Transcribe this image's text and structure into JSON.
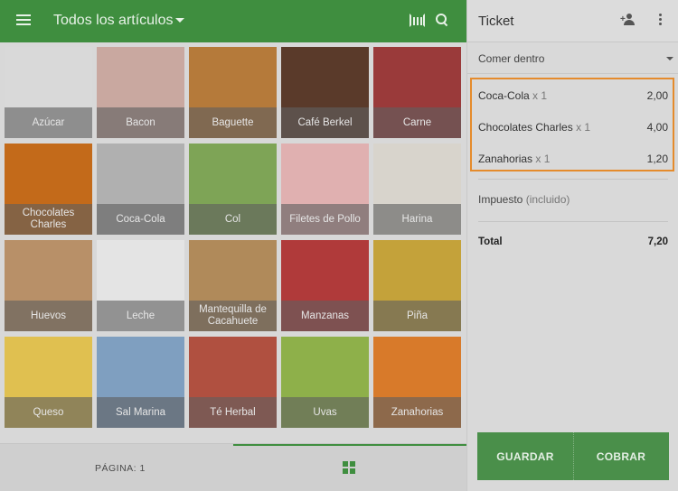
{
  "header": {
    "title": "Todos los artículos"
  },
  "products": [
    {
      "label": "Azúcar",
      "color": "#d9d9d9"
    },
    {
      "label": "Bacon",
      "color": "#c9a8a0"
    },
    {
      "label": "Baguette",
      "color": "#b57a3a"
    },
    {
      "label": "Café Berkel",
      "color": "#5a3a2a"
    },
    {
      "label": "Carne",
      "color": "#9a3a3a"
    },
    {
      "label": "Chocolates Charles",
      "color": "#c36a1a"
    },
    {
      "label": "Coca-Cola",
      "color": "#b0b0b0"
    },
    {
      "label": "Col",
      "color": "#7ea456"
    },
    {
      "label": "Filetes de Pollo",
      "color": "#e0b0b0"
    },
    {
      "label": "Harina",
      "color": "#d8d4cc"
    },
    {
      "label": "Huevos",
      "color": "#b89068"
    },
    {
      "label": "Leche",
      "color": "#e4e4e4"
    },
    {
      "label": "Mantequilla de Cacahuete",
      "color": "#b08a5a"
    },
    {
      "label": "Manzanas",
      "color": "#b03a3a"
    },
    {
      "label": "Piña",
      "color": "#c4a23a"
    },
    {
      "label": "Queso",
      "color": "#e0c050"
    },
    {
      "label": "Sal Marina",
      "color": "#7f9fc0"
    },
    {
      "label": "Té Herbal",
      "color": "#b05040"
    },
    {
      "label": "Uvas",
      "color": "#8eb04a"
    },
    {
      "label": "Zanahorias",
      "color": "#d87a2a"
    }
  ],
  "footer": {
    "page_label": "PÁGINA: 1"
  },
  "ticket": {
    "title": "Ticket",
    "dining_option": "Comer dentro",
    "items": [
      {
        "name": "Coca-Cola",
        "qty": "x 1",
        "price": "2,00"
      },
      {
        "name": "Chocolates Charles",
        "qty": "x 1",
        "price": "4,00"
      },
      {
        "name": "Zanahorias",
        "qty": "x 1",
        "price": "1,20"
      }
    ],
    "tax_label": "Impuesto",
    "tax_note": "(incluido)",
    "total_label": "Total",
    "total_value": "7,20",
    "save_label": "GUARDAR",
    "charge_label": "COBRAR"
  },
  "colors": {
    "accent": "#3f8e3f",
    "highlight": "#e58b2c"
  }
}
